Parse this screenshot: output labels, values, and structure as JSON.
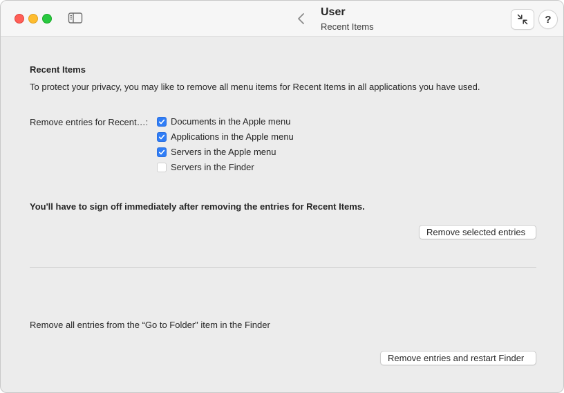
{
  "window": {
    "title": "User",
    "subtitle": "Recent Items",
    "help_label": "?"
  },
  "section": {
    "heading": "Recent Items",
    "description": "To protect your privacy, you may like to remove all menu items for Recent Items in all applications you have used.",
    "remove_label": "Remove entries for Recent…:",
    "options": [
      {
        "label": "Documents in the Apple menu",
        "checked": true
      },
      {
        "label": "Applications in the Apple menu",
        "checked": true
      },
      {
        "label": "Servers in the Apple menu",
        "checked": true
      },
      {
        "label": "Servers in the Finder",
        "checked": false
      }
    ],
    "warning": "You'll have to sign off immediately after removing the entries for Recent Items.",
    "remove_button": "Remove selected entries"
  },
  "goto": {
    "text": "Remove all entries from the “Go to Folder\" item in the Finder",
    "button": "Remove entries and restart Finder"
  },
  "colors": {
    "accent": "#2f7df6",
    "close": "#ff5f57",
    "minimize": "#febc2e",
    "zoom": "#28c840"
  },
  "icons": [
    "sidebar-toggle-icon",
    "chevron-left-icon",
    "collapse-arrows-icon",
    "checkmark-icon"
  ]
}
